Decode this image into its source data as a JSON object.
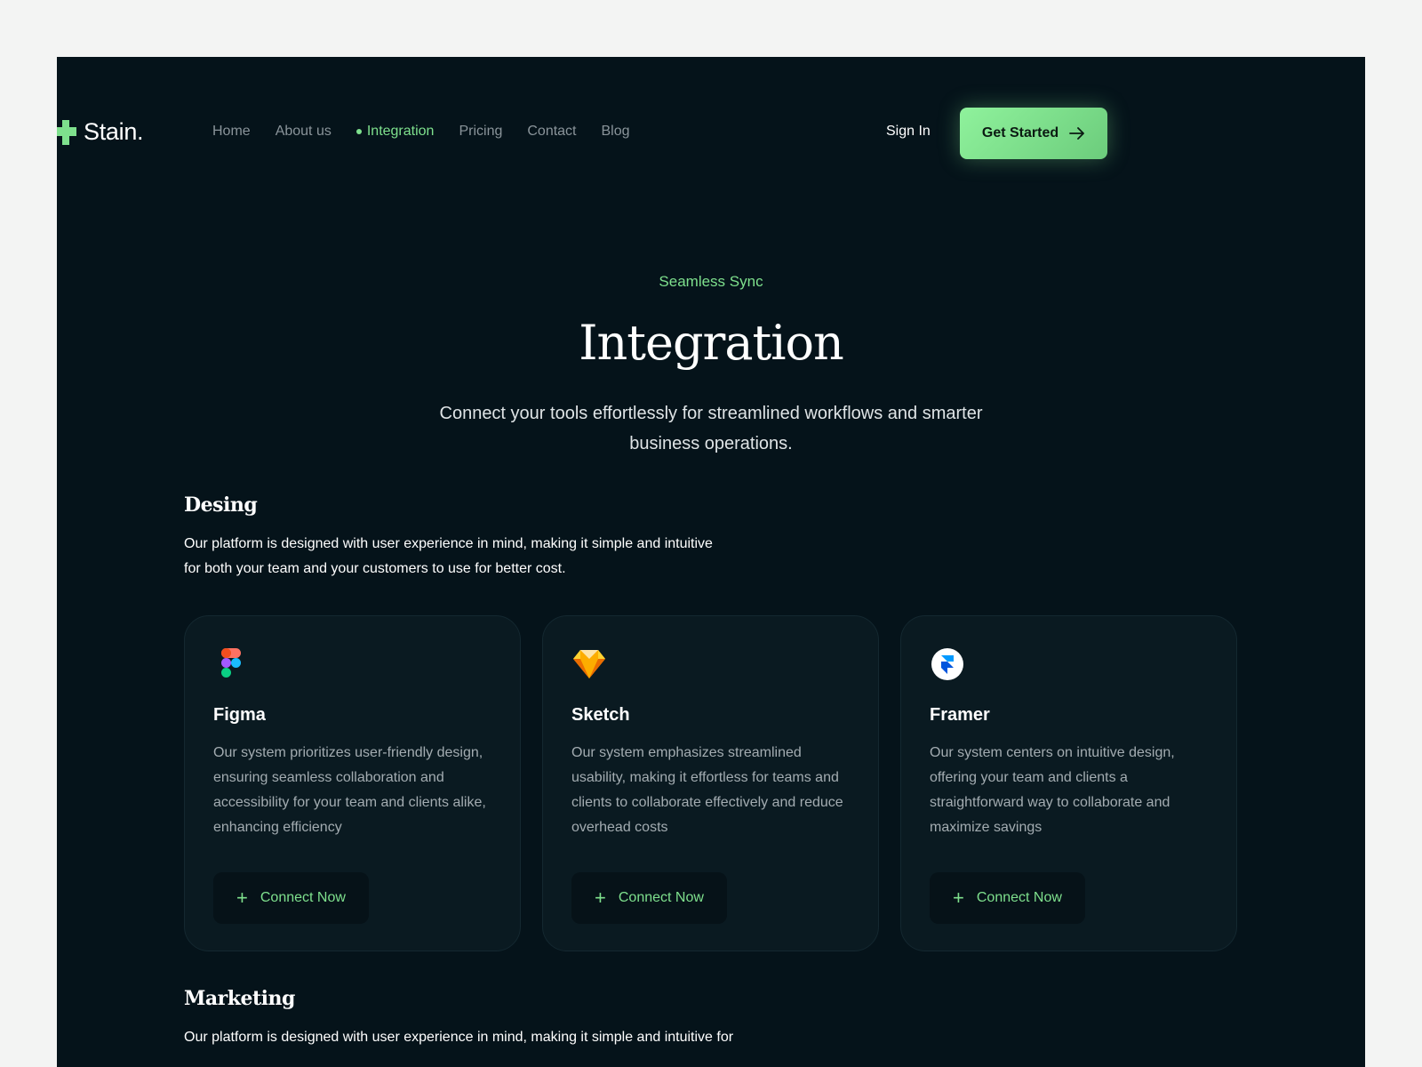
{
  "brand": {
    "name": "Stain."
  },
  "nav": {
    "links": [
      {
        "label": "Home"
      },
      {
        "label": "About us"
      },
      {
        "label": "Integration",
        "active": true
      },
      {
        "label": "Pricing"
      },
      {
        "label": "Contact"
      },
      {
        "label": "Blog"
      }
    ],
    "sign_in": "Sign In",
    "cta": "Get Started"
  },
  "hero": {
    "eyebrow": "Seamless Sync",
    "title": "Integration",
    "subtitle": "Connect your tools effortlessly for streamlined workflows and smarter business operations."
  },
  "sections": [
    {
      "title": "Desing",
      "description_line1": "Our platform is designed with user experience in mind, making it simple and intuitive",
      "description_line2": "for both your team and your customers to use for better cost.",
      "cards": [
        {
          "icon": "figma-icon",
          "title": "Figma",
          "description": "Our system prioritizes user-friendly design, ensuring seamless collaboration and accessibility for your team and clients alike, enhancing efficiency",
          "action": "Connect Now"
        },
        {
          "icon": "sketch-icon",
          "title": "Sketch",
          "description": "Our system emphasizes streamlined usability, making it effortless for teams and clients to collaborate effectively and reduce overhead costs",
          "action": "Connect Now"
        },
        {
          "icon": "framer-icon",
          "title": "Framer",
          "description": "Our system centers on intuitive design, offering your team and clients a straightforward way to collaborate and maximize savings",
          "action": "Connect Now"
        }
      ]
    },
    {
      "title": "Marketing",
      "description_line1": "Our platform is designed with user experience in mind, making it simple and intuitive for"
    }
  ],
  "colors": {
    "background": "#05131a",
    "accent": "#7ee08d",
    "card": "#0a1a21",
    "page": "#f3f4f3"
  }
}
